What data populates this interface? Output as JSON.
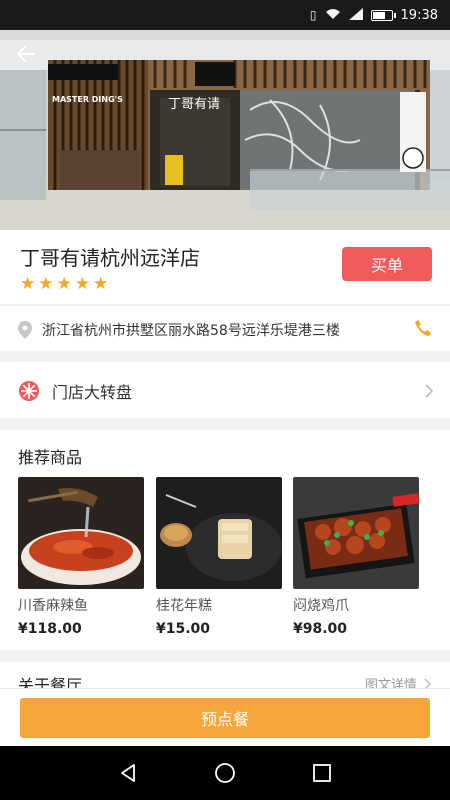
{
  "status_bar": {
    "time": "19:38",
    "network": "4G"
  },
  "store": {
    "name": "丁哥有请杭州远洋店",
    "rating_stars": 5,
    "buy_label": "买单",
    "address": "浙江省杭州市拱墅区丽水路58号远洋乐堤港三楼",
    "signage_en": "MASTER DING'S",
    "signage_cn": "丁哥有请"
  },
  "wheel": {
    "label": "门店大转盘"
  },
  "products": {
    "title": "推荐商品",
    "items": [
      {
        "name": "川香麻辣鱼",
        "price": "¥118.00"
      },
      {
        "name": "桂花年糕",
        "price": "¥15.00"
      },
      {
        "name": "闷烧鸡爪",
        "price": "¥98.00"
      }
    ]
  },
  "about": {
    "title": "关于餐厅",
    "detail_label": "图文详情"
  },
  "bottom": {
    "preorder_label": "预点餐"
  },
  "colors": {
    "buy": "#f05a5a",
    "star": "#f5a623",
    "preorder": "#f6a53a",
    "phone": "#f5a623",
    "wheel_icon": "#f05a5a"
  },
  "icons": [
    "back-arrow-icon",
    "location-pin-icon",
    "phone-icon",
    "wheel-icon",
    "chevron-right-icon",
    "nav-back-icon",
    "nav-home-icon",
    "nav-recents-icon"
  ]
}
